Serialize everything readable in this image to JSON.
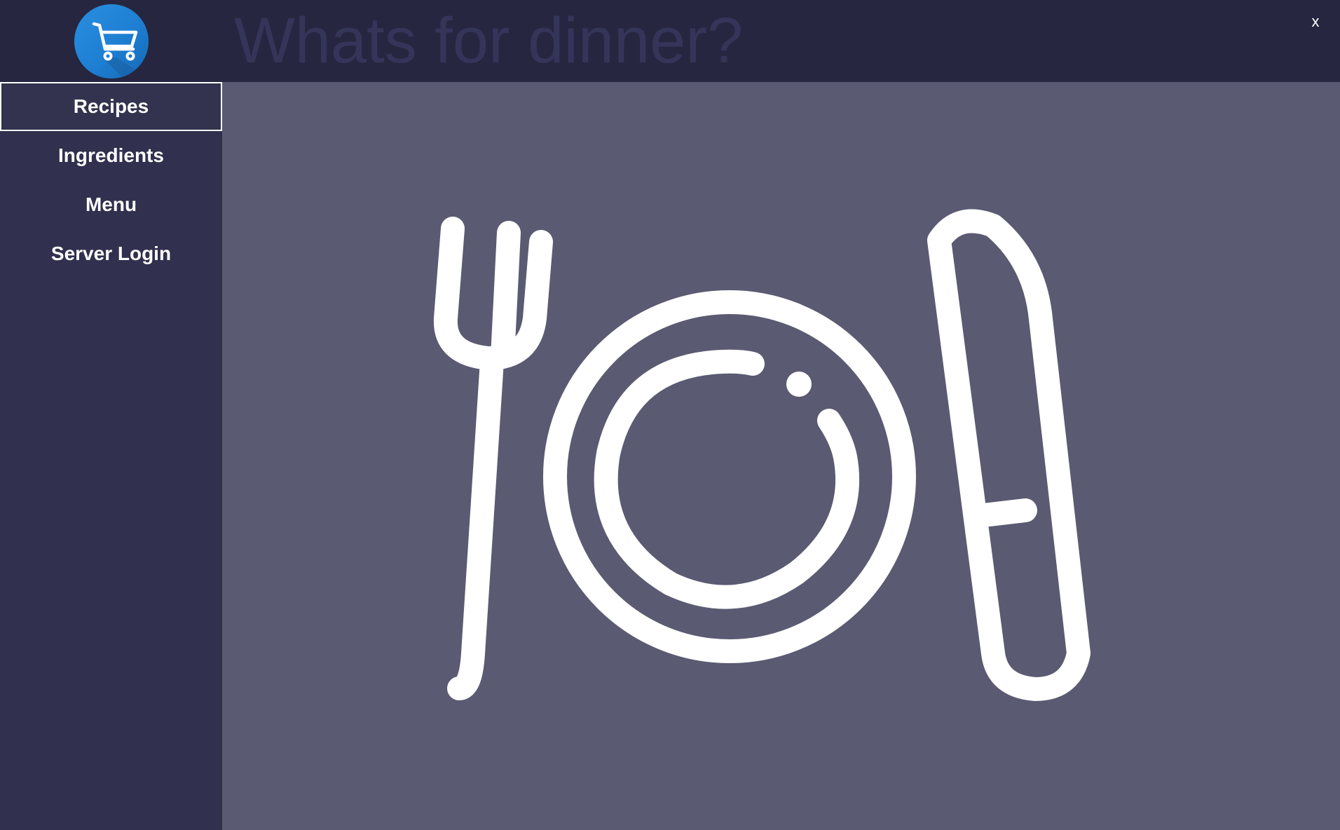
{
  "app": {
    "title": "Whats for dinner?",
    "close_label": "x",
    "logo_icon": "shopping-cart-icon"
  },
  "sidebar": {
    "items": [
      {
        "label": "Recipes",
        "active": true
      },
      {
        "label": "Ingredients",
        "active": false
      },
      {
        "label": "Menu",
        "active": false
      },
      {
        "label": "Server Login",
        "active": false
      }
    ]
  },
  "main": {
    "hero_icon": "plate-fork-knife-icon"
  },
  "colors": {
    "titlebar_bg": "#262640",
    "sidebar_bg": "#31304e",
    "content_bg": "#5a5a72",
    "logo_blue": "#1e7fd3",
    "title_text": "#35355a",
    "icon_white": "#ffffff"
  }
}
